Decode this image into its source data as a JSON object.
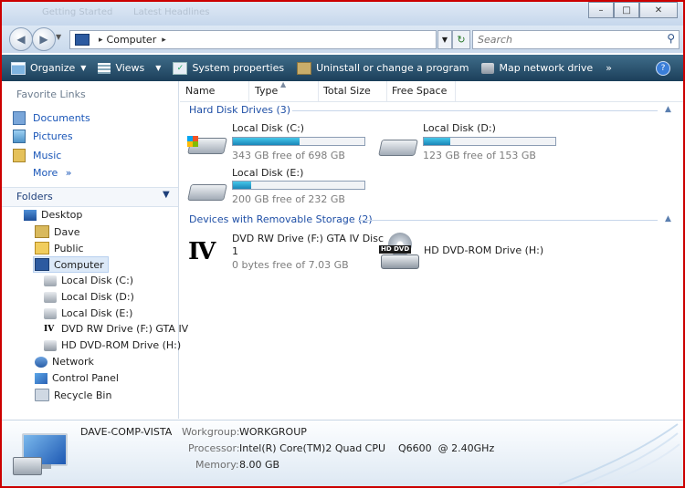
{
  "window": {
    "bg_tabs": [
      "Getting Started",
      "Latest Headlines"
    ]
  },
  "address": {
    "crumb": "Computer",
    "search_placeholder": "Search"
  },
  "toolbar": {
    "organize": "Organize",
    "views": "Views",
    "system_properties": "System properties",
    "uninstall": "Uninstall or change a program",
    "map_drive": "Map network drive",
    "more": "»"
  },
  "nav": {
    "favorites_title": "Favorite Links",
    "favorites": [
      "Documents",
      "Pictures",
      "Music"
    ],
    "more": "More",
    "folders_title": "Folders",
    "tree": [
      "Desktop",
      "Dave",
      "Public",
      "Computer",
      "Local Disk (C:)",
      "Local Disk (D:)",
      "Local Disk (E:)",
      "DVD RW Drive (F:) GTA IV",
      "HD DVD-ROM Drive (H:)",
      "Network",
      "Control Panel",
      "Recycle Bin"
    ]
  },
  "columns": [
    "Name",
    "Type",
    "Total Size",
    "Free Space"
  ],
  "groups": {
    "hdd": "Hard Disk Drives (3)",
    "removable": "Devices with Removable Storage (2)"
  },
  "drives": [
    {
      "name": "Local Disk (C:)",
      "free": "343 GB free of 698 GB",
      "used_fraction": 0.51
    },
    {
      "name": "Local Disk (D:)",
      "free": "123 GB free of 153 GB",
      "used_fraction": 0.2
    },
    {
      "name": "Local Disk (E:)",
      "free": "200 GB free of 232 GB",
      "used_fraction": 0.14
    }
  ],
  "removable": [
    {
      "name_line1": "DVD RW Drive (F:) GTA IV Disc",
      "name_line2": "1",
      "free": "0 bytes free of 7.03 GB",
      "logo": "IV"
    },
    {
      "name": "HD DVD-ROM Drive (H:)",
      "badge": "HD DVD"
    }
  ],
  "details": {
    "computer_name": "DAVE-COMP-VISTA",
    "workgroup_label": "Workgroup:",
    "workgroup": "WORKGROUP",
    "processor_label": "Processor:",
    "processor": "Intel(R) Core(TM)2 Quad CPU    Q6600  @ 2.40GHz",
    "memory_label": "Memory:",
    "memory": "8.00 GB"
  },
  "colors": {
    "accent": "#1f4fa6",
    "bar_fill": "#2aa4d4",
    "toolbar": "#2a5470"
  }
}
